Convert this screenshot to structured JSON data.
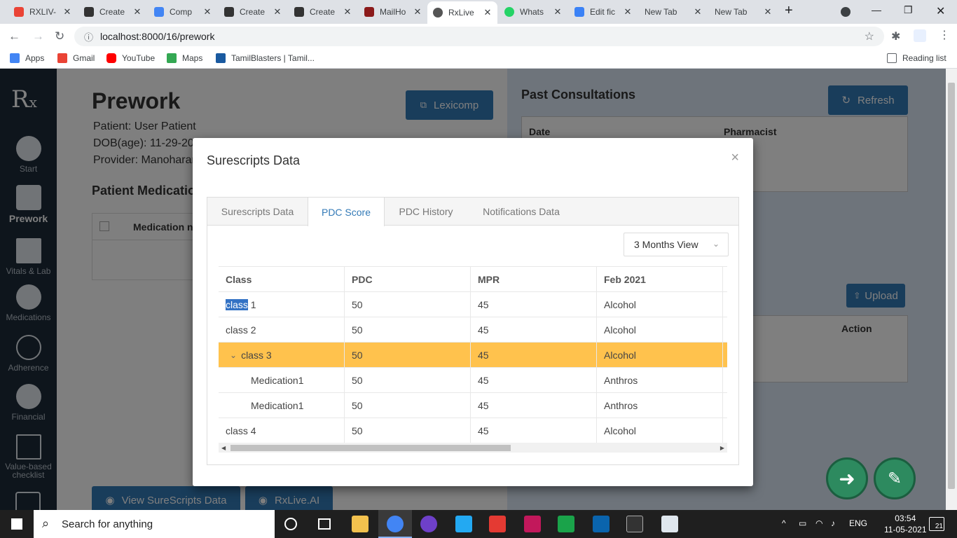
{
  "browser": {
    "tabs": [
      {
        "title": "RXLIV-",
        "color": "#ea4335"
      },
      {
        "title": "Create",
        "color": "#333"
      },
      {
        "title": "Comp",
        "color": "#4285f4"
      },
      {
        "title": "Create",
        "color": "#333"
      },
      {
        "title": "Create",
        "color": "#333"
      },
      {
        "title": "MailHo",
        "color": "#8b1a1a"
      },
      {
        "title": "RxLive",
        "color": "#555"
      },
      {
        "title": "Whats",
        "color": "#25d366"
      },
      {
        "title": "Edit fic",
        "color": "#3b82f6"
      },
      {
        "title": "New Tab",
        "color": ""
      },
      {
        "title": "New Tab",
        "color": ""
      }
    ],
    "url": "localhost:8000/16/prework",
    "bookmarks": [
      "Apps",
      "Gmail",
      "YouTube",
      "Maps",
      "TamilBlasters | Tamil..."
    ],
    "reading_list": "Reading list"
  },
  "sidebar": {
    "items": [
      {
        "label": "Start"
      },
      {
        "label": "Prework"
      },
      {
        "label": "Vitals & Lab"
      },
      {
        "label": "Medications"
      },
      {
        "label": "Adherence"
      },
      {
        "label": "Financial"
      },
      {
        "label": "Value-based checklist"
      }
    ]
  },
  "background": {
    "title": "Prework",
    "patient": "Patient: User Patient",
    "dob": "DOB(age): 11-29-20",
    "provider": "Provider: Manoharan",
    "lexicomp": "Lexicomp",
    "past_consultations": "Past Consultations",
    "refresh": "Refresh",
    "date_header": "Date",
    "pharmacist_header": "Pharmacist",
    "patient_medications": "Patient Medicatio",
    "medication_name_header": "Medication na",
    "upload": "Upload",
    "action_header": "Action",
    "view_surescripts": "View SureScripts Data",
    "rxlive_ai": "RxLive.AI"
  },
  "modal": {
    "title": "Surescripts Data",
    "tabs": [
      "Surescripts Data",
      "PDC Score",
      "PDC History",
      "Notifications Data"
    ],
    "active_tab": "PDC Score",
    "view_select": "3 Months View",
    "table": {
      "headers": [
        "Class",
        "PDC",
        "MPR",
        "Feb 2021"
      ],
      "rows": [
        {
          "class_sel": "class",
          "class_rest": " 1",
          "pdc": "50",
          "mpr": "45",
          "feb": "Alcohol"
        },
        {
          "class": "class 2",
          "pdc": "50",
          "mpr": "45",
          "feb": "Alcohol"
        },
        {
          "class": "class 3",
          "pdc": "50",
          "mpr": "45",
          "feb": "Alcohol"
        },
        {
          "class": "Medication1",
          "pdc": "50",
          "mpr": "45",
          "feb": "Anthros"
        },
        {
          "class": "Medication1",
          "pdc": "50",
          "mpr": "45",
          "feb": "Anthros"
        },
        {
          "class": "class 4",
          "pdc": "50",
          "mpr": "45",
          "feb": "Alcohol"
        }
      ]
    }
  },
  "taskbar": {
    "search_placeholder": "Search for anything",
    "lang": "ENG",
    "time": "03:54",
    "date": "11-05-2021",
    "notif": "21"
  }
}
